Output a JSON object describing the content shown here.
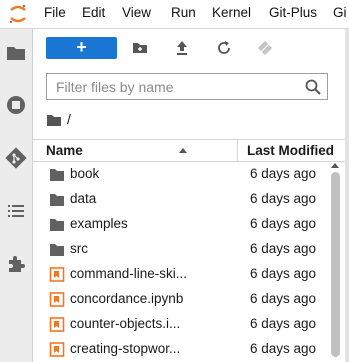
{
  "menu": {
    "items": [
      "File",
      "Edit",
      "View",
      "Run",
      "Kernel",
      "Git-Plus",
      "Gi"
    ]
  },
  "activity_bar": {
    "icons": [
      "folder-icon",
      "running-icon",
      "git-icon",
      "toc-icon",
      "extension-icon"
    ]
  },
  "toolbar": {
    "new_launcher_label": "+",
    "buttons": [
      "new-folder-icon",
      "upload-icon",
      "refresh-icon",
      "git-clone-icon"
    ]
  },
  "filter": {
    "placeholder": "Filter files by name"
  },
  "breadcrumb": {
    "separator": "/"
  },
  "listing": {
    "columns": {
      "name": "Name",
      "modified": "Last Modified"
    },
    "sort_direction": "ascending",
    "rows": [
      {
        "name": "book",
        "type": "folder",
        "modified": "6 days ago"
      },
      {
        "name": "data",
        "type": "folder",
        "modified": "6 days ago"
      },
      {
        "name": "examples",
        "type": "folder",
        "modified": "6 days ago"
      },
      {
        "name": "src",
        "type": "folder",
        "modified": "6 days ago"
      },
      {
        "name": "command-line-ski...",
        "type": "notebook",
        "modified": "6 days ago"
      },
      {
        "name": "concordance.ipynb",
        "type": "notebook",
        "modified": "6 days ago"
      },
      {
        "name": "counter-objects.i...",
        "type": "notebook",
        "modified": "6 days ago"
      },
      {
        "name": "creating-stopwor...",
        "type": "notebook",
        "modified": "6 days ago"
      }
    ]
  },
  "colors": {
    "accent": "#1976d2",
    "notebook_icon": "#f37626",
    "logo": "#f37726"
  }
}
